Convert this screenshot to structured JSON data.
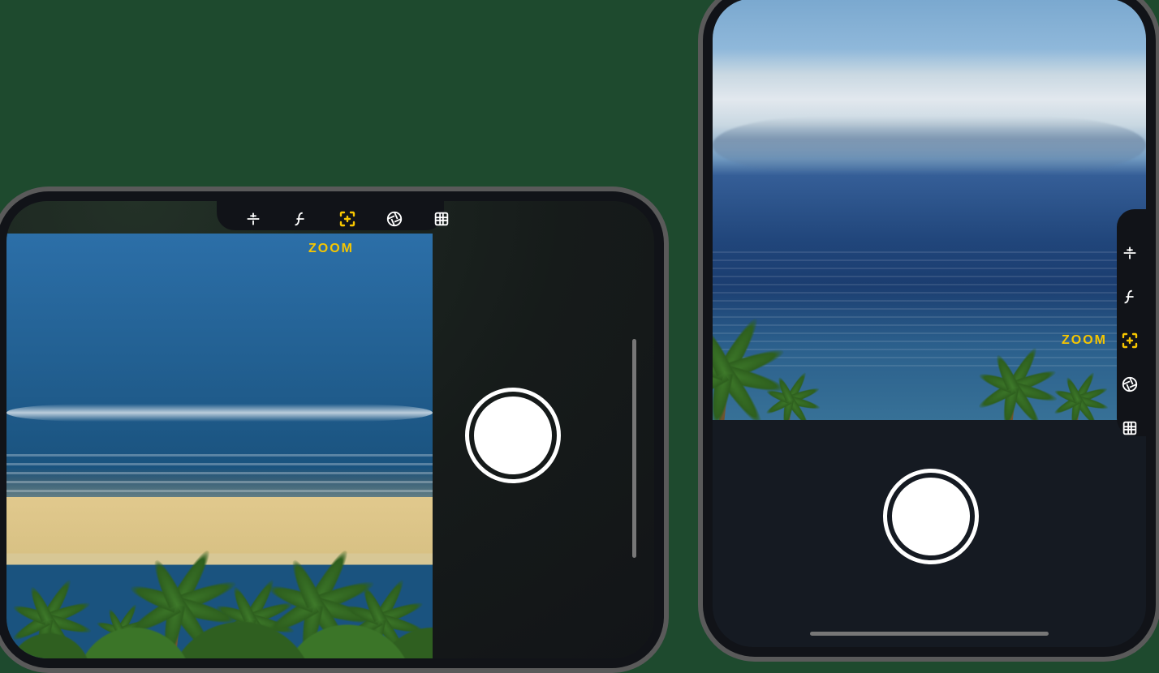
{
  "colors": {
    "accent": "#f7c600",
    "icon": "#ffffff",
    "chassis": "#5a5a5a",
    "frame": "#111318"
  },
  "landscape": {
    "zoom_label": "ZOOM",
    "toolbar": [
      {
        "id": "exposure",
        "name": "exposure-icon",
        "active": false
      },
      {
        "id": "aperture",
        "name": "f-number-icon",
        "active": false
      },
      {
        "id": "zoom",
        "name": "zoom-bracket-icon",
        "active": true
      },
      {
        "id": "shutter",
        "name": "shutter-speed-icon",
        "active": false
      },
      {
        "id": "grid",
        "name": "grid-icon",
        "active": false
      }
    ]
  },
  "portrait": {
    "zoom_label": "ZOOM",
    "toolbar": [
      {
        "id": "exposure",
        "name": "exposure-icon",
        "active": false
      },
      {
        "id": "aperture",
        "name": "f-number-icon",
        "active": false
      },
      {
        "id": "zoom",
        "name": "zoom-bracket-icon",
        "active": true
      },
      {
        "id": "shutter",
        "name": "shutter-speed-icon",
        "active": false
      },
      {
        "id": "grid",
        "name": "grid-icon",
        "active": false
      }
    ]
  }
}
